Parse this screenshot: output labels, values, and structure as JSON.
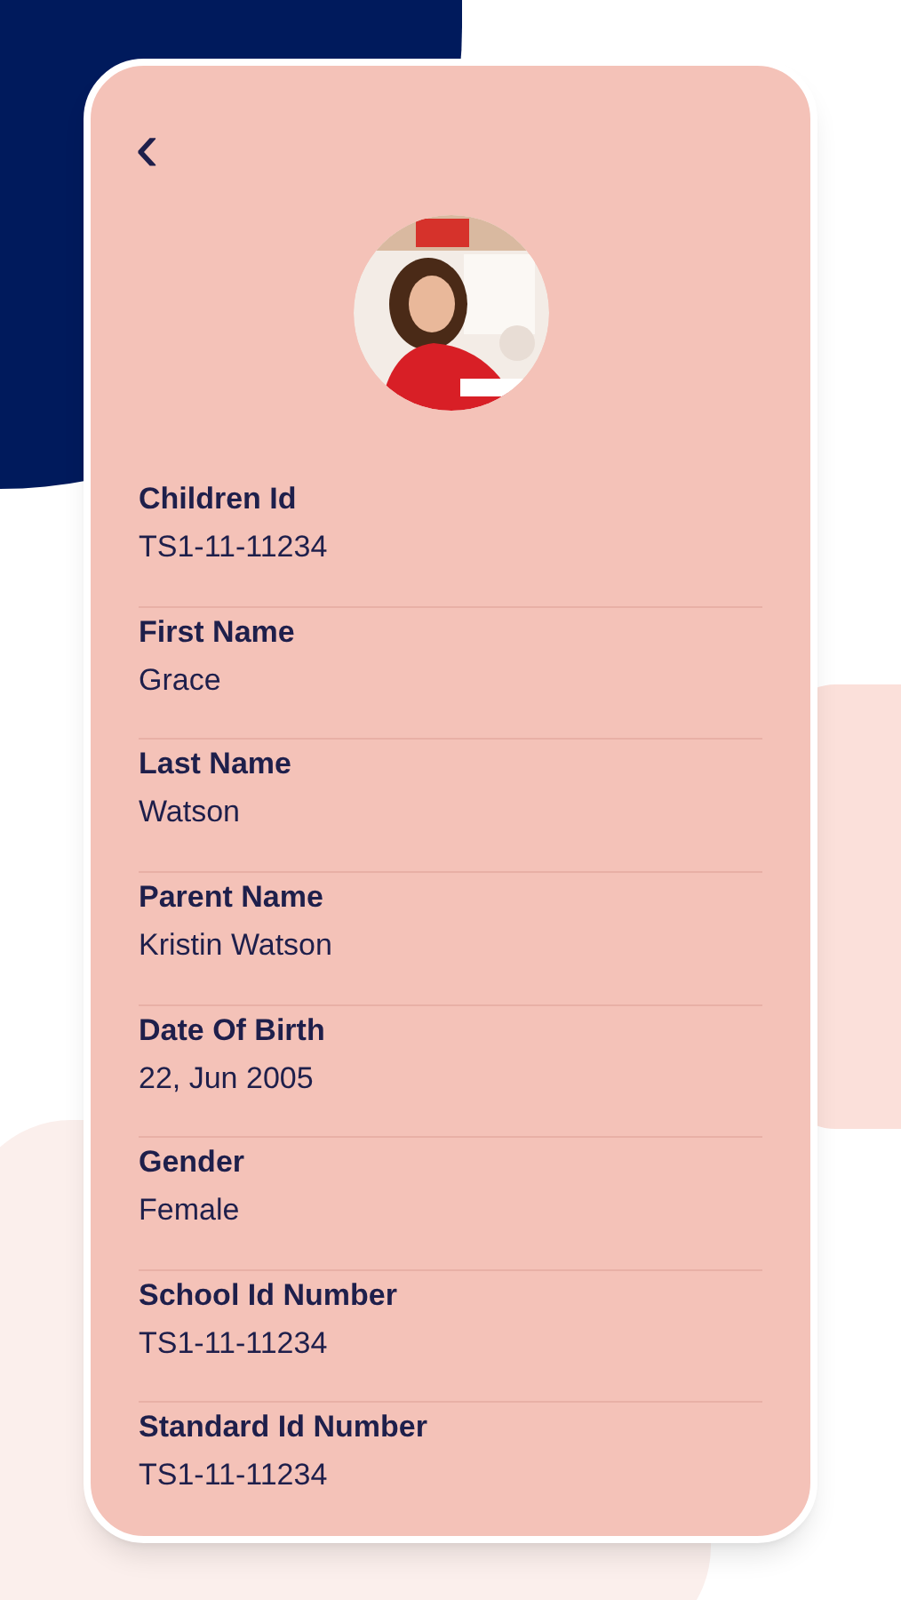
{
  "back_button": {
    "label": "‹"
  },
  "fields": [
    {
      "label": "Children Id",
      "value": "TS1-11-11234"
    },
    {
      "label": "First Name",
      "value": "Grace"
    },
    {
      "label": "Last Name",
      "value": "Watson"
    },
    {
      "label": "Parent Name",
      "value": "Kristin Watson"
    },
    {
      "label": "Date Of Birth",
      "value": "22, Jun 2005"
    },
    {
      "label": "Gender",
      "value": "Female"
    },
    {
      "label": "School Id Number",
      "value": "TS1-11-11234"
    },
    {
      "label": "Standard Id Number",
      "value": "TS1-11-11234"
    }
  ]
}
